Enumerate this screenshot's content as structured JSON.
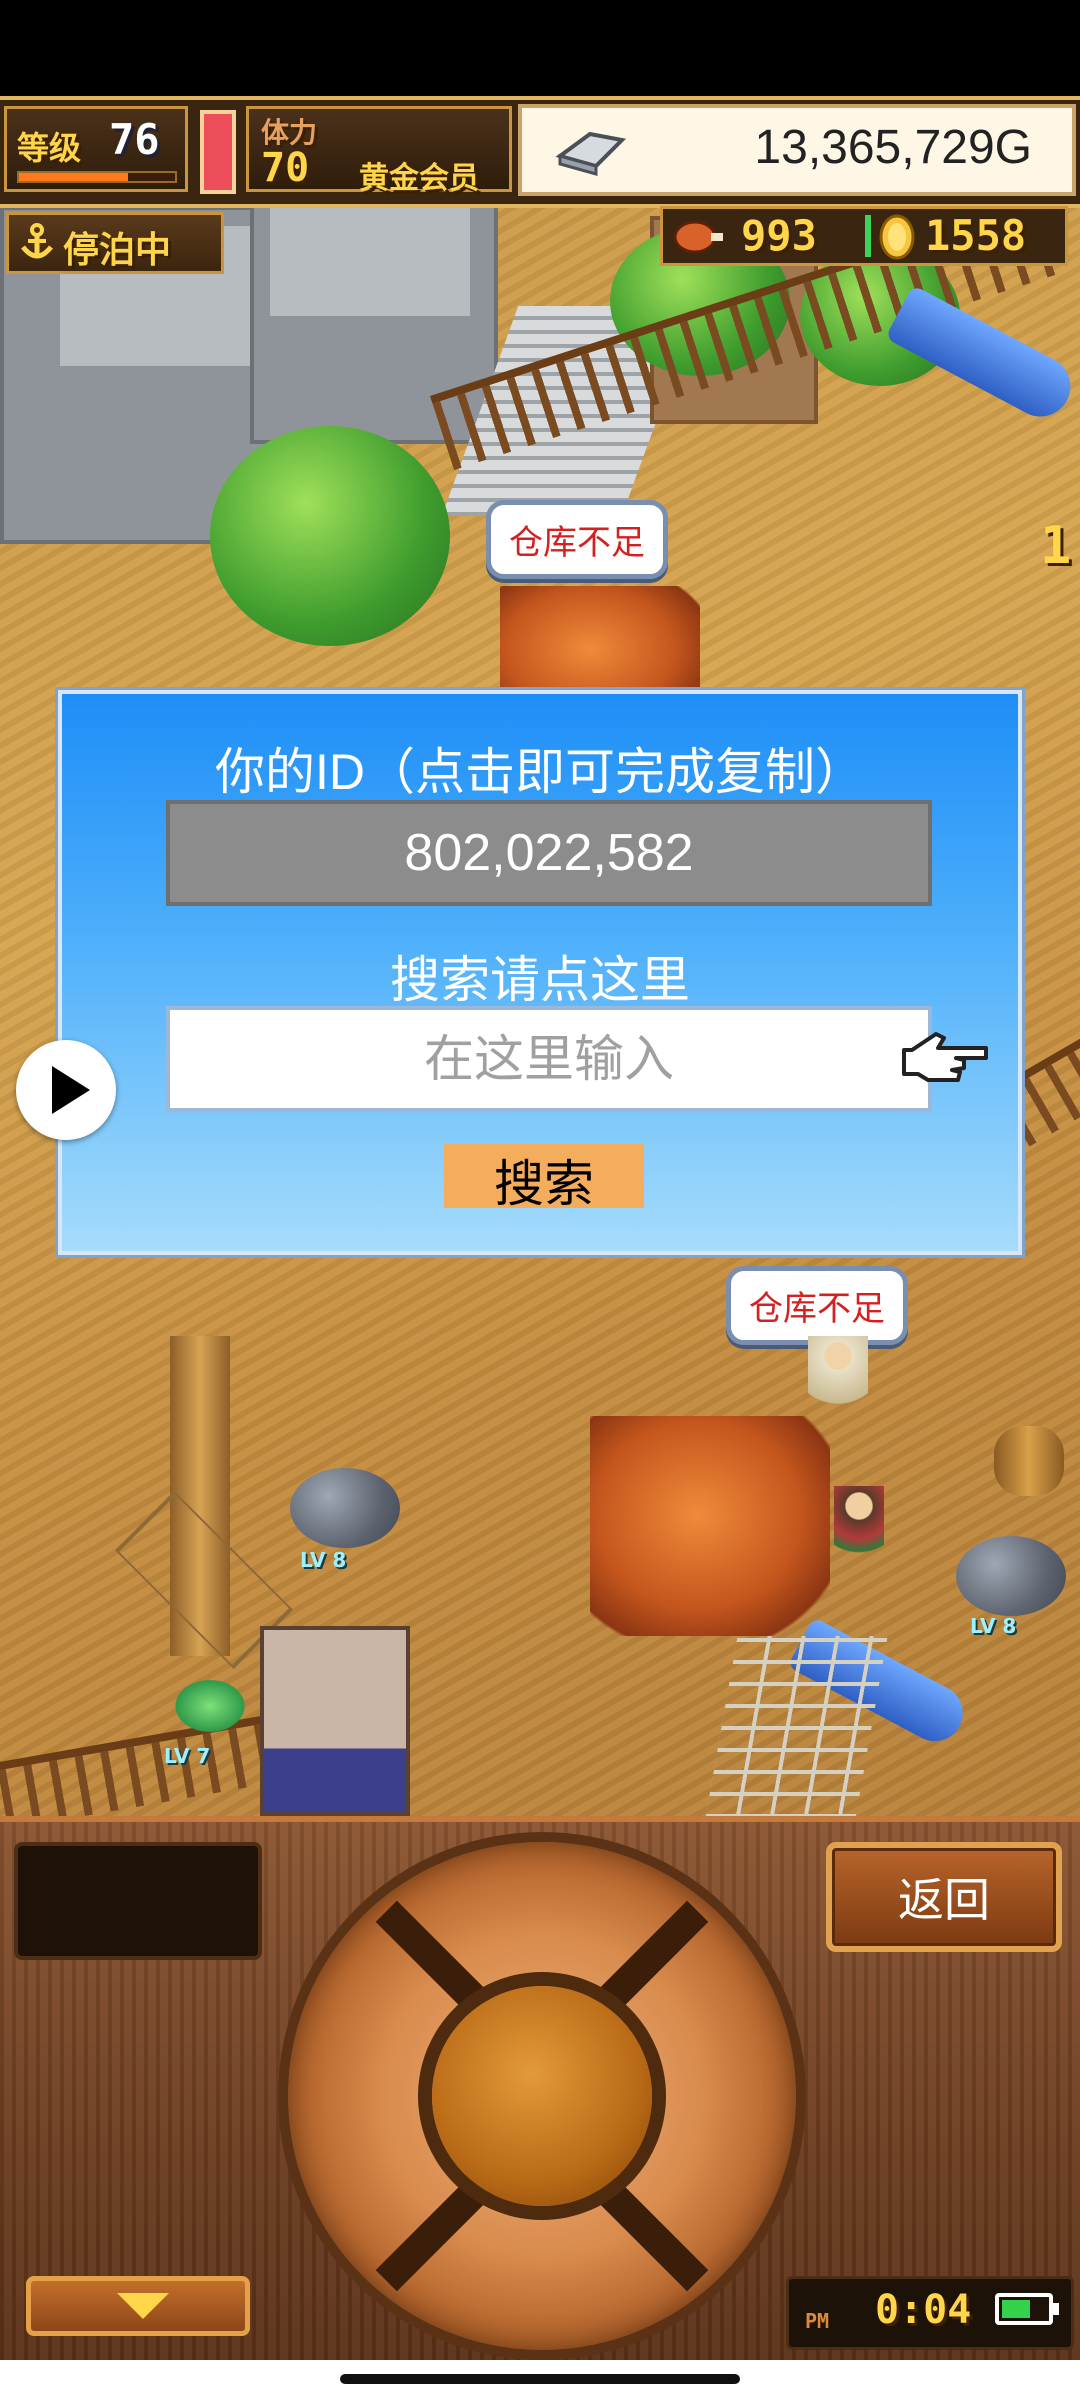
{
  "hud": {
    "level_label": "等级",
    "level_value": "76",
    "stamina_label": "体力",
    "stamina_value": "70",
    "membership": "黄金会员",
    "gold_amount": "13,365,729G",
    "dock_status": "停泊中",
    "food_count": "993",
    "medal_count": "1558",
    "side_number": "1"
  },
  "scene": {
    "bubble_top": "仓库不足",
    "bubble_right": "仓库不足",
    "lv_left": "LV 8",
    "lv_right": "LV 8",
    "lv_plant": "LV 7"
  },
  "dialog": {
    "title": "你的ID（点击即可完成复制）",
    "user_id": "802,022,582",
    "search_hint": "搜索请点这里",
    "search_placeholder": "在这里输入",
    "search_value": "",
    "search_button": "搜索"
  },
  "controls": {
    "back_button": "返回",
    "clock_ampm": "PM",
    "clock_time": "0:04"
  },
  "colors": {
    "dialog_top": "#1e8ef7",
    "dialog_bottom": "#a6dcfb",
    "search_button_bg": "#f4ad5c",
    "bubble_text": "#d52020",
    "hud_gold_text": "#ffd54a"
  },
  "icons": {
    "anchor": "anchor-icon",
    "silver_bar": "silver-bar-icon",
    "food": "meat-icon",
    "medal": "gold-medal-icon",
    "play": "play-icon",
    "hand": "pointing-hand-icon",
    "down": "down-arrow-icon",
    "battery": "battery-icon"
  }
}
